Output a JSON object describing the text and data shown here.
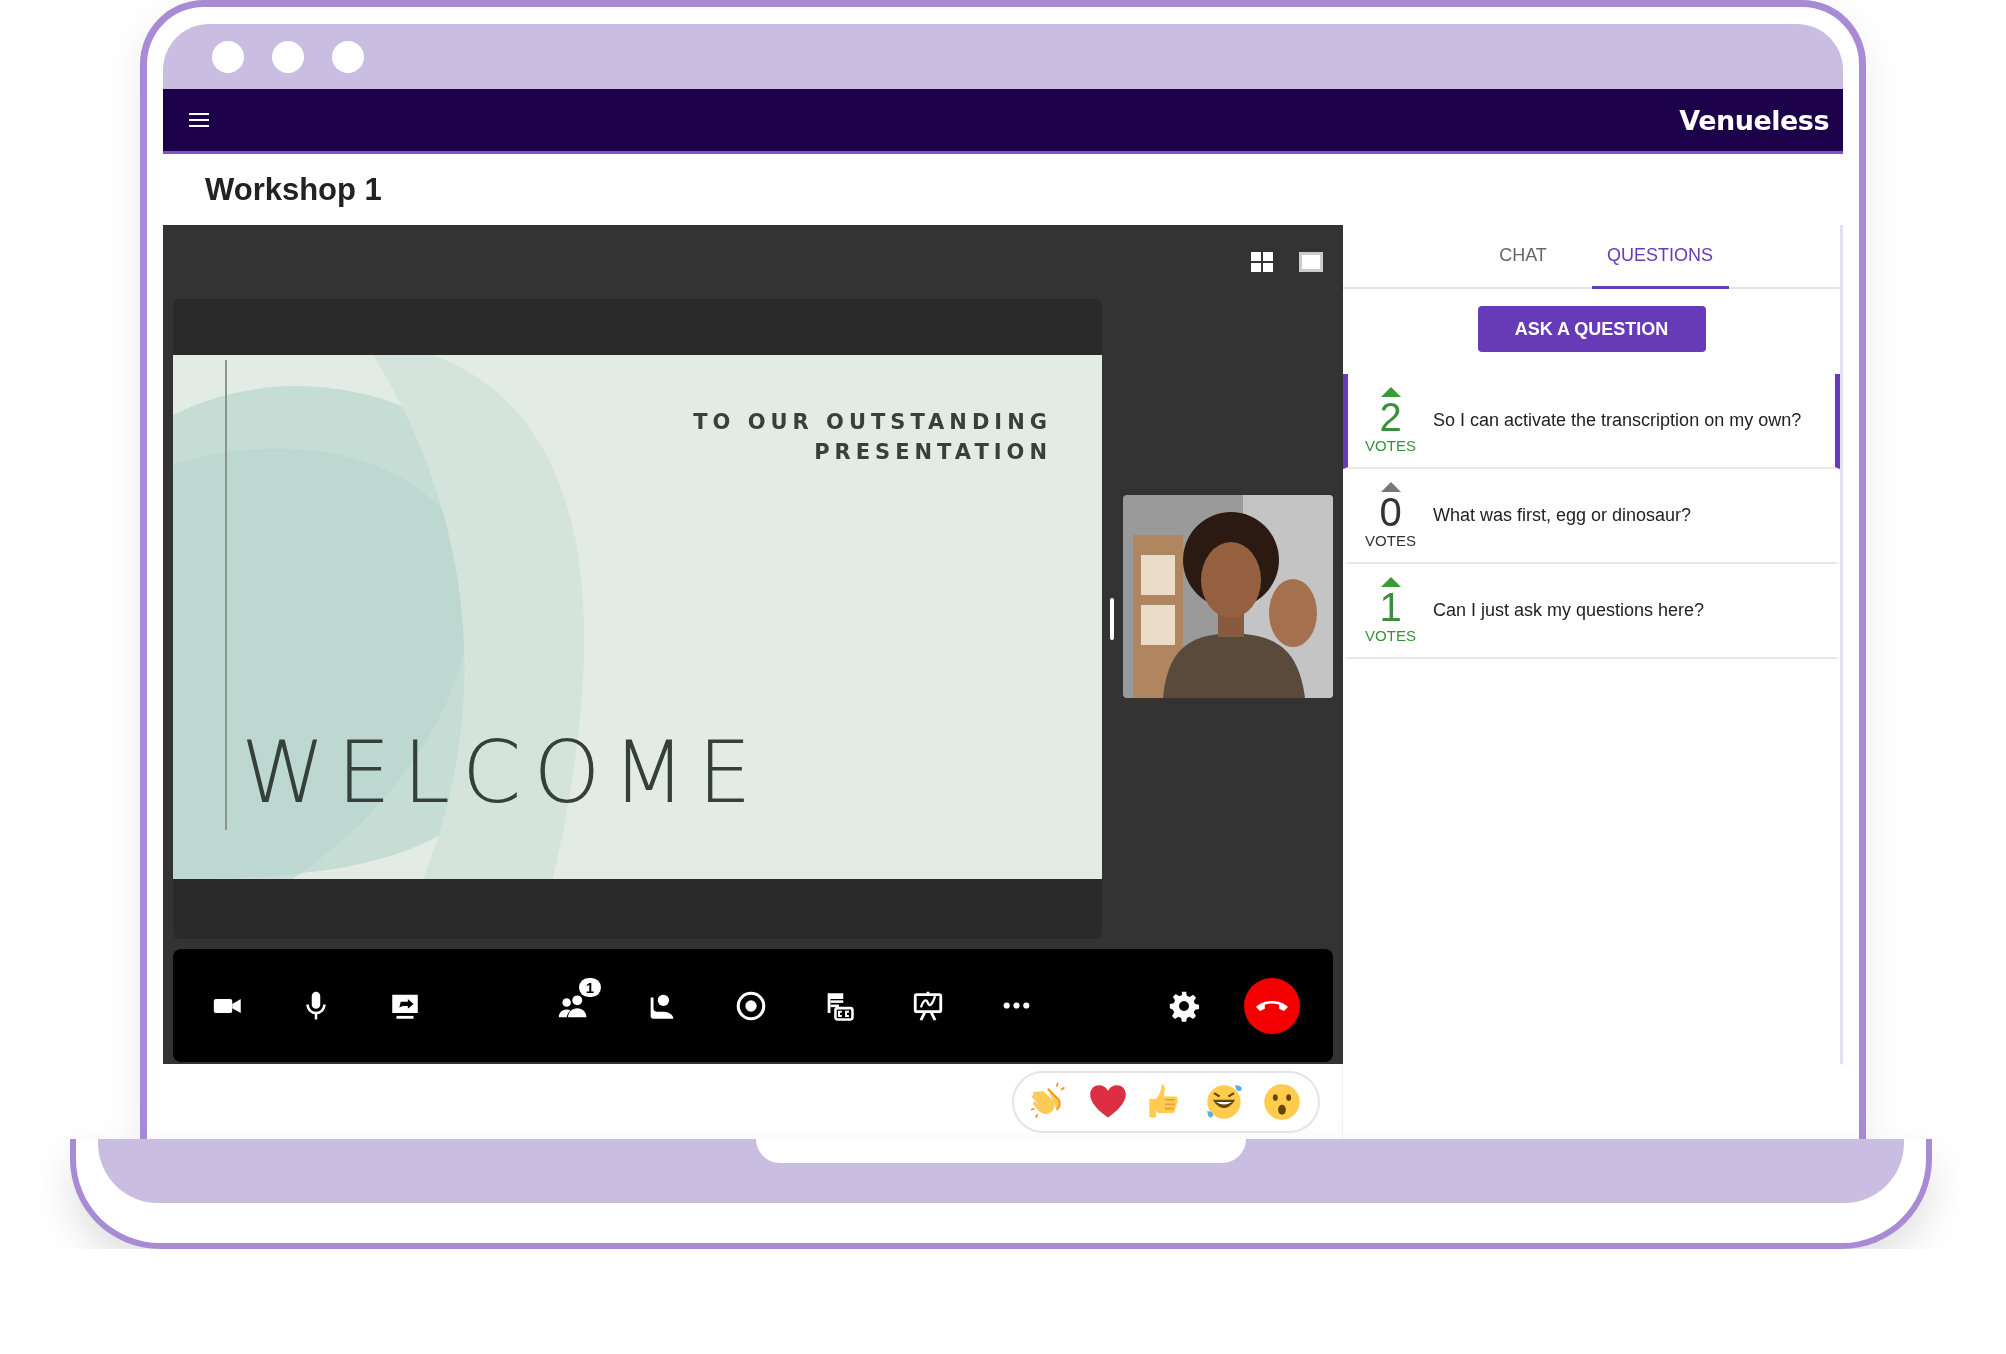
{
  "nav": {
    "logo": "Venueless"
  },
  "page": {
    "title": "Workshop 1"
  },
  "stage": {
    "slide": {
      "subtitle_lines": [
        "TO OUR OUTSTANDING",
        "PRESENTATION"
      ],
      "title": "WELCOME"
    },
    "toolbar": [
      {
        "kind": "camera"
      },
      {
        "kind": "mic"
      },
      {
        "kind": "screenshare"
      },
      {
        "kind": "participants",
        "badge": "1"
      },
      {
        "kind": "person"
      },
      {
        "kind": "record"
      },
      {
        "kind": "captions"
      },
      {
        "kind": "whiteboard"
      },
      {
        "kind": "more"
      },
      {
        "kind": "settings"
      },
      {
        "kind": "hangup"
      }
    ],
    "reactions": [
      {
        "kind": "clap"
      },
      {
        "kind": "heart"
      },
      {
        "kind": "thumbsup"
      },
      {
        "kind": "laugh"
      },
      {
        "kind": "surprised"
      }
    ]
  },
  "sidebar": {
    "tabs": [
      {
        "label": "CHAT",
        "selected": false
      },
      {
        "label": "QUESTIONS",
        "selected": true
      }
    ],
    "ask_button": "ASK A QUESTION",
    "questions": [
      {
        "votes": "2",
        "votes_label": "VOTES",
        "text": "So I can activate the transcription on my own?",
        "upvoted": true,
        "selected": true
      },
      {
        "votes": "0",
        "votes_label": "VOTES",
        "text": "What was first, egg or dinosaur?",
        "upvoted": false,
        "selected": false
      },
      {
        "votes": "1",
        "votes_label": "VOTES",
        "text": "Can I just ask my questions here?",
        "upvoted": true,
        "selected": false
      }
    ]
  }
}
